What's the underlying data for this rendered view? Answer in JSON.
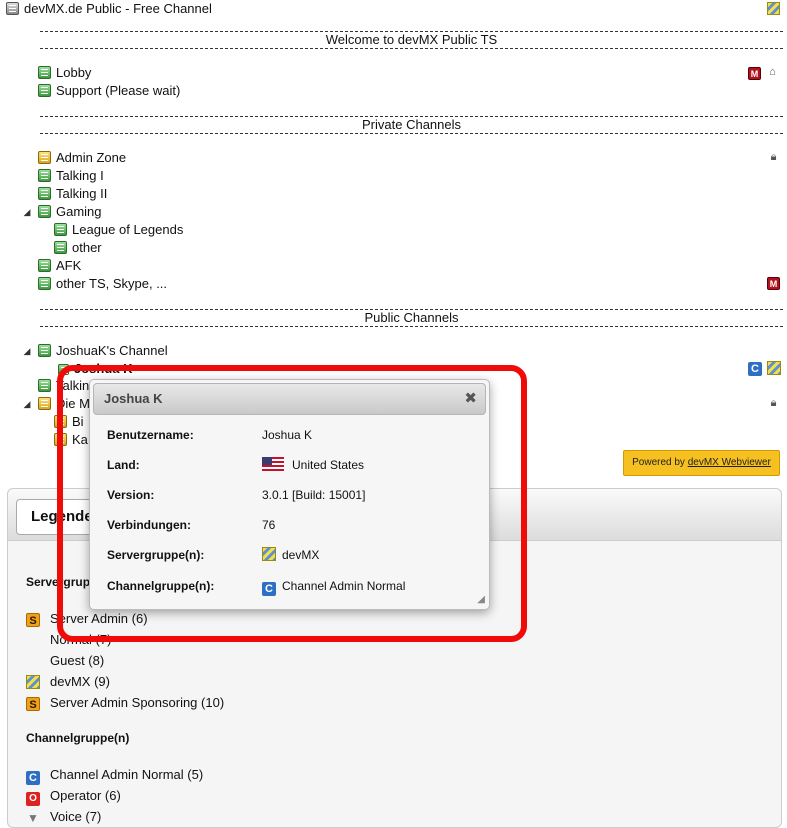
{
  "server": {
    "title": "devMX.de Public - Free Channel"
  },
  "spacers": {
    "welcome": "Welcome to devMX Public TS",
    "private": "Private Channels",
    "public": "Public Channels"
  },
  "channels": {
    "lobby": "Lobby",
    "support": "Support (Please wait)",
    "admin_zone": "Admin Zone",
    "talking1": "Talking I",
    "talking2": "Talking II",
    "gaming": "Gaming",
    "lol": "League of Legends",
    "other": "other",
    "afk": "AFK",
    "other_ts": "other TS, Skype, ...",
    "joshua_channel": "JoshuaK's Channel",
    "joshua_user": "Joshua K",
    "talkin_partial": "Talkin",
    "die_m_partial": "Die M",
    "bi_partial": "Bi",
    "ka_partial": "Ka"
  },
  "icons": {
    "m_badge": "M",
    "c_badge": "C",
    "o_badge": "O",
    "s_badge": "S"
  },
  "powered": {
    "prefix": "Powered by ",
    "link": "devMX Webviewer"
  },
  "popup": {
    "title": "Joshua K",
    "close": "✖",
    "rows": [
      {
        "key": "Benutzername:",
        "value": "Joshua K"
      },
      {
        "key": "Land:",
        "value": "United States"
      },
      {
        "key": "Version:",
        "value": "3.0.1 [Build: 15001]"
      },
      {
        "key": "Verbindungen:",
        "value": "76"
      },
      {
        "key": "Servergruppe(n):",
        "value": "devMX"
      },
      {
        "key": "Channelgruppe(n):",
        "value": "Channel Admin Normal"
      }
    ]
  },
  "legend": {
    "tab": "Legende",
    "server_groups_heading": "Servergruppe(n)",
    "server_groups": [
      "Server Admin (6)",
      "Normal (7)",
      "Guest (8)",
      "devMX (9)",
      "Server Admin Sponsoring (10)"
    ],
    "channel_groups_heading": "Channelgruppe(n)",
    "channel_groups": [
      "Channel Admin Normal (5)",
      "Operator (6)",
      "Voice (7)"
    ]
  },
  "colors": {
    "highlight": "#f10a0a",
    "powered_bg": "#f5c020",
    "c_badge": "#2f6fc3"
  }
}
